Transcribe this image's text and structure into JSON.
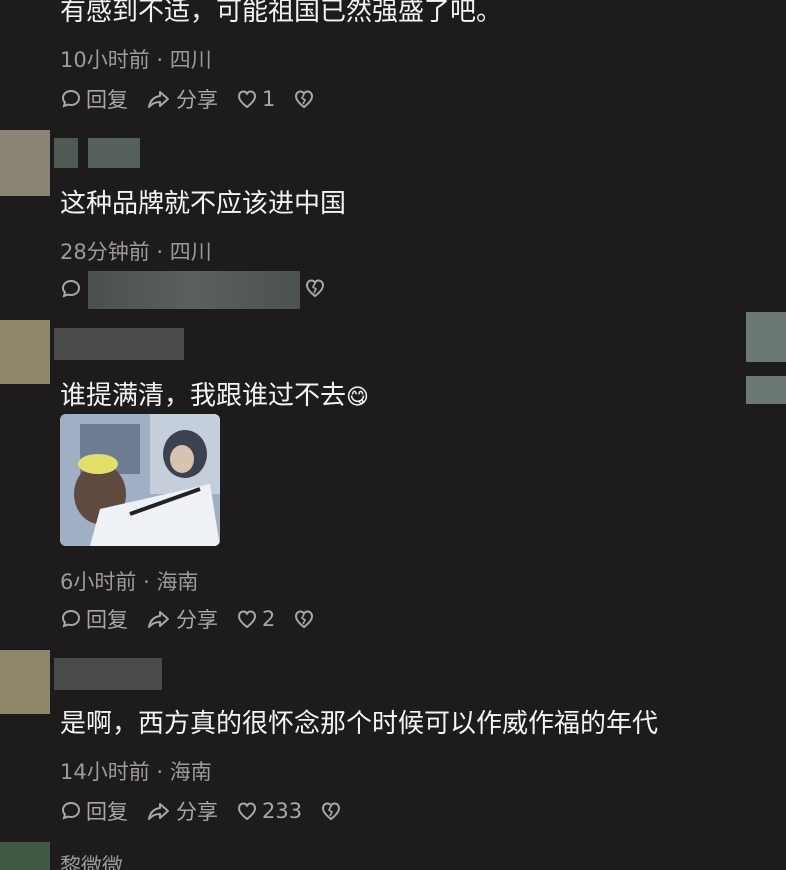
{
  "comments": [
    {
      "text": "有感到不适，可能祖国已然强盛了吧。",
      "time": "10小时前",
      "location": "四川",
      "reply_label": "回复",
      "share_label": "分享",
      "likes": "1"
    },
    {
      "text": "这种品牌就不应该进中国",
      "time": "28分钟前",
      "location": "四川"
    },
    {
      "text": "谁提满清，我跟谁过不去",
      "emoji": "😋",
      "time": "6小时前",
      "location": "海南",
      "reply_label": "回复",
      "share_label": "分享",
      "likes": "2"
    },
    {
      "text": "是啊，西方真的很怀念那个时候可以作威作福的年代",
      "time": "14小时前",
      "location": "海南",
      "reply_label": "回复",
      "share_label": "分享",
      "likes": "233"
    },
    {
      "username": "黎微微"
    }
  ],
  "separator": "·",
  "colors": {
    "background": "#1e1b1c",
    "text": "#f4f4f4",
    "meta": "#9d9a9b"
  }
}
